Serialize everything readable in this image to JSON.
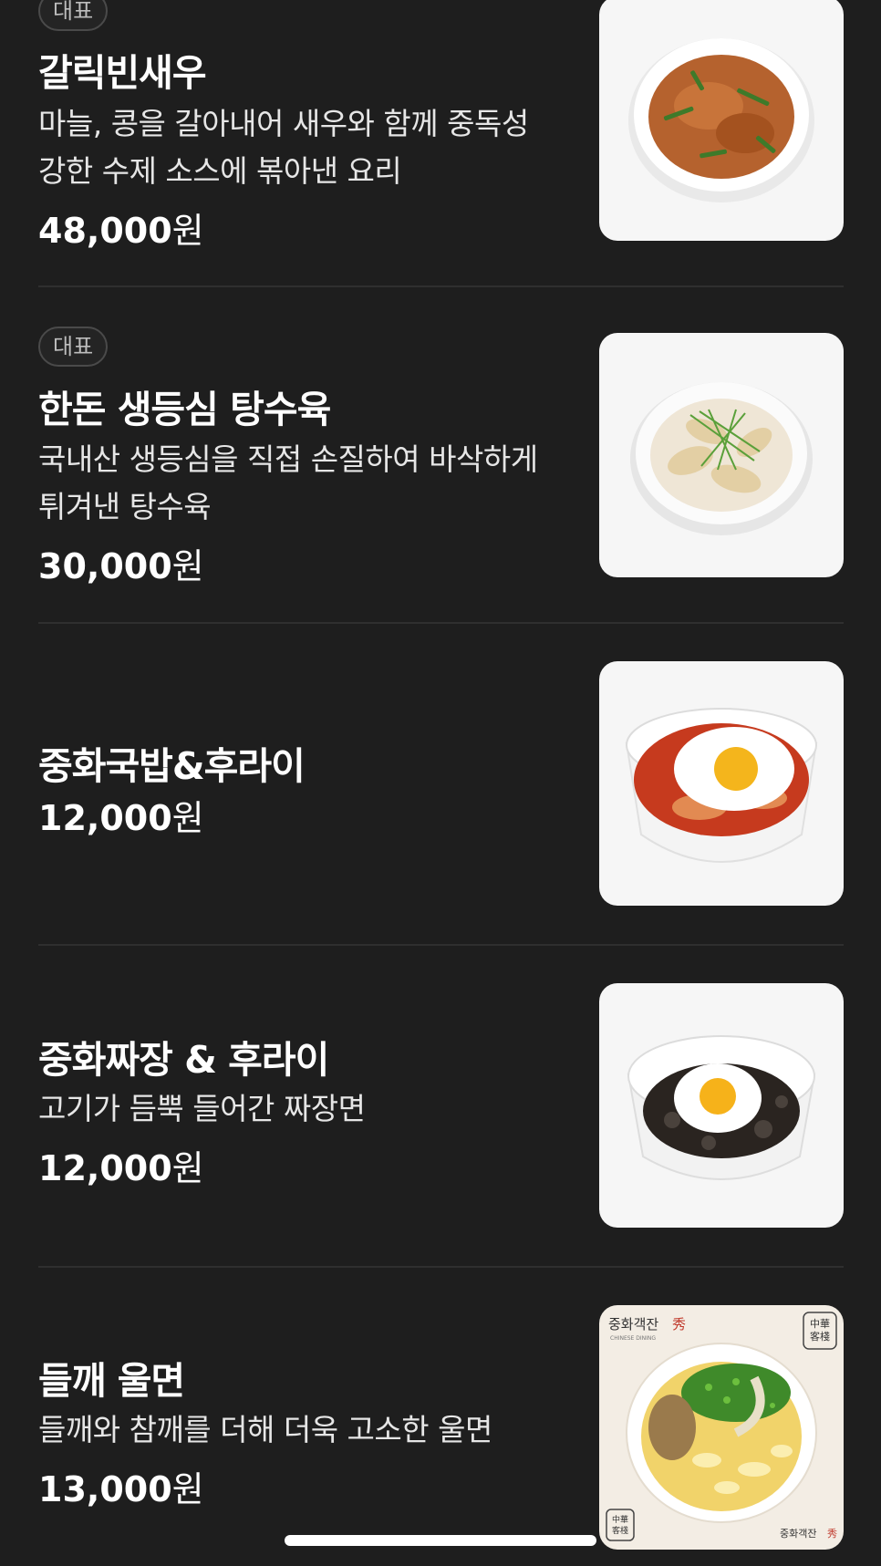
{
  "menu": {
    "items": [
      {
        "badge": "대표",
        "name": "갈릭빈새우",
        "description": "마늘, 콩을 갈아내어 새우와 함께 중독성 강한 수제 소스에 볶아낸 요리",
        "price": "48,000",
        "currency": "원",
        "image_icon": "garlic-shrimp-dish-image"
      },
      {
        "badge": "대표",
        "name": "한돈 생등심 탕수육",
        "description": "국내산 생등심을 직접 손질하여 바삭하게 튀겨낸 탕수육",
        "price": "30,000",
        "currency": "원",
        "image_icon": "sweet-sour-pork-dish-image"
      },
      {
        "name": "중화국밥&후라이",
        "price": "12,000",
        "currency": "원",
        "image_icon": "spicy-soup-rice-egg-image"
      },
      {
        "name": "중화짜장 & 후라이",
        "description": "고기가 듬뿍 들어간 짜장면",
        "price": "12,000",
        "currency": "원",
        "image_icon": "jjajang-egg-image"
      },
      {
        "name": "들깨 울면",
        "description": "들깨와 참깨를 더해 더욱 고소한 울면",
        "price": "13,000",
        "currency": "원",
        "image_icon": "perilla-ulmyeon-image",
        "image_texts": {
          "brand_ko": "중화객잔",
          "brand_mark": "秀",
          "brand_en": "CHINESE DINING",
          "seal": "中華客棧"
        }
      }
    ]
  },
  "colors": {
    "background": "#1e1e1e",
    "text_primary": "#ffffff",
    "badge_border": "#4a4a4a",
    "divider": "#2f2f2f"
  }
}
